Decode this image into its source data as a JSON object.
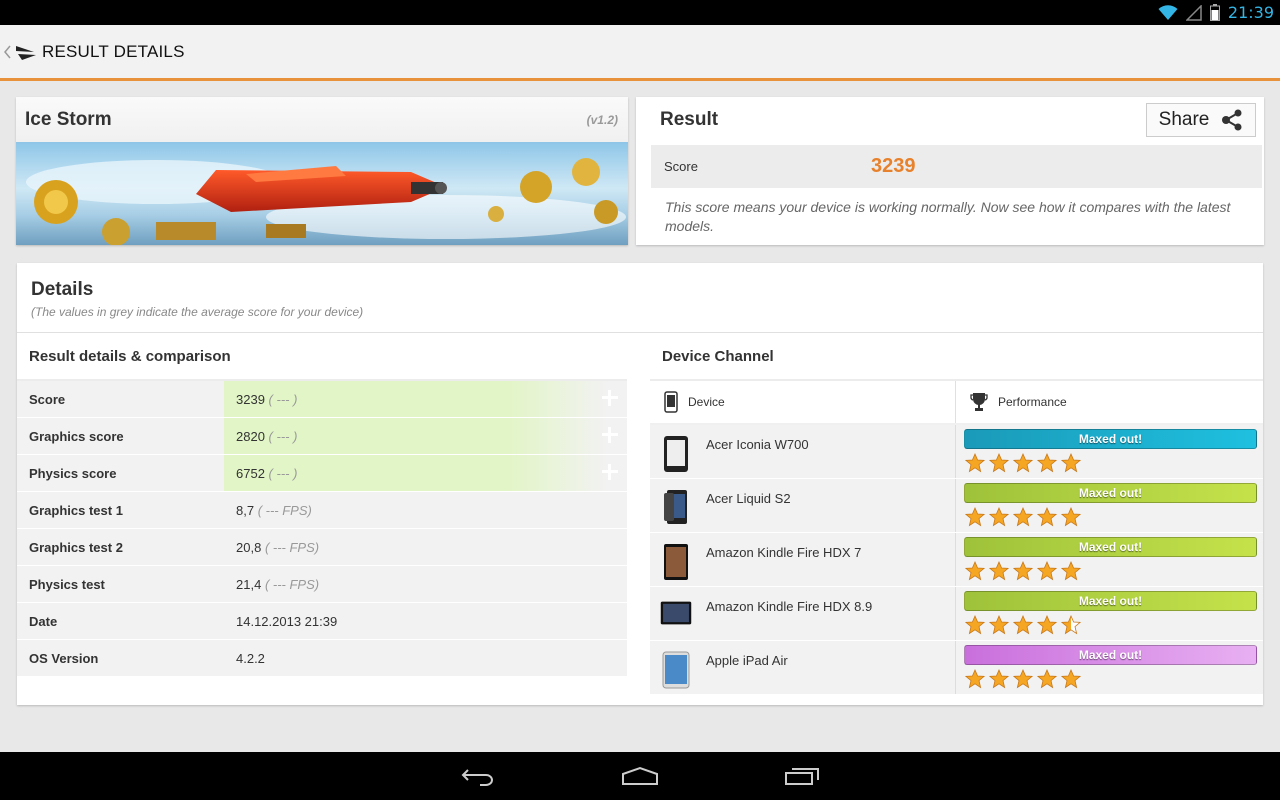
{
  "status_bar": {
    "time": "21:39"
  },
  "action_bar": {
    "title": "RESULT DETAILS"
  },
  "test": {
    "name": "Ice Storm",
    "version": "(v1.2)"
  },
  "result": {
    "title": "Result",
    "share_label": "Share",
    "score_label": "Score",
    "score_value": "3239",
    "note": "This score means your device is working normally. Now see how it compares with the latest models."
  },
  "details": {
    "title": "Details",
    "subtitle": "(The values in grey indicate the average score for your device)",
    "left_title": "Result details & comparison",
    "rows": [
      {
        "label": "Score",
        "value": "3239",
        "avg": "( --- )",
        "highlight": true
      },
      {
        "label": "Graphics score",
        "value": "2820",
        "avg": "( --- )",
        "highlight": true
      },
      {
        "label": "Physics score",
        "value": "6752",
        "avg": "( --- )",
        "highlight": true
      },
      {
        "label": "Graphics test 1",
        "value": "8,7",
        "avg": "( --- FPS)"
      },
      {
        "label": "Graphics test 2",
        "value": "20,8",
        "avg": "( --- FPS)"
      },
      {
        "label": "Physics test",
        "value": "21,4",
        "avg": "( --- FPS)"
      },
      {
        "label": "Date",
        "value": "14.12.2013 21:39",
        "avg": ""
      },
      {
        "label": "OS Version",
        "value": "4.2.2",
        "avg": ""
      }
    ]
  },
  "device_channel": {
    "title": "Device Channel",
    "col_device": "Device",
    "col_performance": "Performance",
    "devices": [
      {
        "name": "Acer Iconia W700",
        "bar_label": "Maxed out!",
        "bar_color": "#1fb0d0",
        "rating": 5
      },
      {
        "name": "Acer Liquid S2",
        "bar_label": "Maxed out!",
        "bar_color": "#b3d641",
        "rating": 5
      },
      {
        "name": "Amazon Kindle Fire HDX 7",
        "bar_label": "Maxed out!",
        "bar_color": "#b3d641",
        "rating": 5
      },
      {
        "name": "Amazon Kindle Fire HDX 8.9",
        "bar_label": "Maxed out!",
        "bar_color": "#b3d641",
        "rating": 4.5
      },
      {
        "name": "Apple iPad Air",
        "bar_label": "Maxed out!",
        "bar_color": "#d88be8",
        "rating": 5
      }
    ]
  },
  "colors": {
    "accent": "#e8923b",
    "score": "#e8812c",
    "status_blue": "#33b5e5"
  }
}
